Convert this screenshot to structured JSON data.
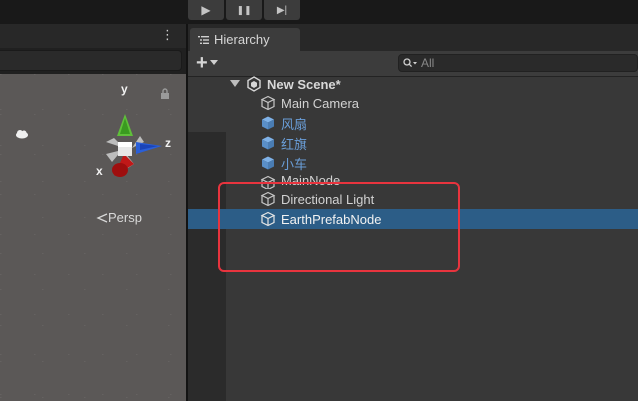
{
  "toolbar": {
    "buttons": [
      {
        "name": "play-icon",
        "glyph": "▶"
      },
      {
        "name": "pause-icon",
        "glyph": "❚❚"
      },
      {
        "name": "step-icon",
        "glyph": "▶|"
      }
    ]
  },
  "scene": {
    "menu_glyph": "⋮",
    "gizmo": {
      "y": "y",
      "z": "z",
      "x": "x"
    },
    "persp_label": "Persp"
  },
  "hierarchy": {
    "tab_label": "Hierarchy",
    "add_glyph": "+",
    "search_placeholder": "All",
    "scene_name": "New Scene*",
    "items": [
      {
        "label": "Main Camera",
        "prefab": false
      },
      {
        "label": "风扇",
        "prefab": true
      },
      {
        "label": "红旗",
        "prefab": true
      },
      {
        "label": "小车",
        "prefab": true
      },
      {
        "label": "MainNode",
        "prefab": false
      },
      {
        "label": "Directional Light",
        "prefab": false
      },
      {
        "label": "EarthPrefabNode",
        "prefab": false,
        "selected": true
      }
    ]
  },
  "colors": {
    "selection": "#2c5d87",
    "prefab_text": "#6a9ed8",
    "annotation": "#e8343e"
  }
}
